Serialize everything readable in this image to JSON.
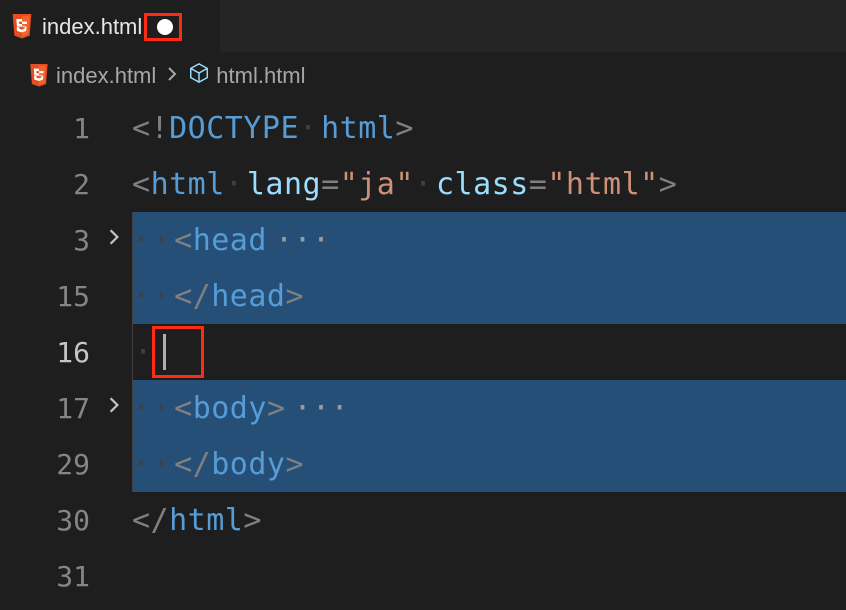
{
  "tab": {
    "filename": "index.html"
  },
  "breadcrumb": {
    "file": "index.html",
    "symbol": "html.html"
  },
  "lines": {
    "n1": "1",
    "n2": "2",
    "n3": "3",
    "n15": "15",
    "n16": "16",
    "n17": "17",
    "n29": "29",
    "n30": "30",
    "n31": "31"
  },
  "code": {
    "l1_doctype_open": "<!",
    "l1_doctype_word": "DOCTYPE",
    "l1_doctype_sp": "·",
    "l1_doctype_html": "html",
    "l1_doctype_close": ">",
    "l2_open": "<",
    "l2_tag": "html",
    "l2_sp1": "·",
    "l2_attr1": "lang",
    "l2_eq1": "=",
    "l2_val1": "\"ja\"",
    "l2_sp2": "·",
    "l2_attr2": "class",
    "l2_eq2": "=",
    "l2_val2": "\"html\"",
    "l2_close": ">",
    "l3_indent": "··",
    "l3_open": "<",
    "l3_tag": "head",
    "l3_dots": "···",
    "l15_indent": "··",
    "l15_open": "</",
    "l15_tag": "head",
    "l15_close": ">",
    "l16_indent": "·",
    "l17_indent": "··",
    "l17_open": "<",
    "l17_tag": "body",
    "l17_close": ">",
    "l17_dots": "···",
    "l29_indent": "··",
    "l29_open": "</",
    "l29_tag": "body",
    "l29_close": ">",
    "l30_open": "</",
    "l30_tag": "html",
    "l30_close": ">"
  }
}
